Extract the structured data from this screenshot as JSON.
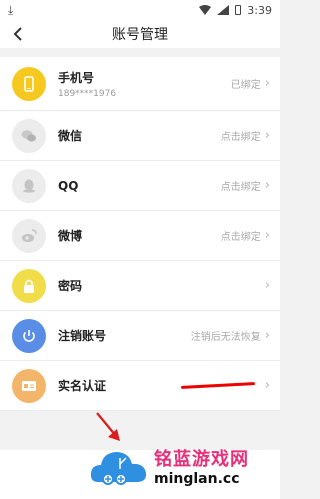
{
  "status_bar": {
    "time": "3:39"
  },
  "header": {
    "title": "账号管理"
  },
  "accounts": [
    {
      "name": "row-phone",
      "icon": "phone-icon",
      "icon_color": "#f5c91f",
      "label": "手机号",
      "sub": "189****1976",
      "status": "已绑定"
    },
    {
      "name": "row-wechat",
      "icon": "wechat-icon",
      "icon_color": "#ececec",
      "label": "微信",
      "status": "点击绑定"
    },
    {
      "name": "row-qq",
      "icon": "qq-icon",
      "icon_color": "#ececec",
      "label": "QQ",
      "status": "点击绑定"
    },
    {
      "name": "row-weibo",
      "icon": "weibo-icon",
      "icon_color": "#ececec",
      "label": "微博",
      "status": "点击绑定"
    },
    {
      "name": "row-password",
      "icon": "lock-icon",
      "icon_color": "#f1dd4a",
      "label": "密码",
      "status": ""
    },
    {
      "name": "row-deregister",
      "icon": "power-icon",
      "icon_color": "#5a8de6",
      "label": "注销账号",
      "status": "注销后无法恢复"
    },
    {
      "name": "row-realname",
      "icon": "id-card-icon",
      "icon_color": "#f3b56a",
      "label": "实名认证",
      "status": ""
    }
  ],
  "watermark": {
    "cn_a": "铭蓝",
    "cn_b": "游戏网",
    "en": "minglan.cc"
  }
}
